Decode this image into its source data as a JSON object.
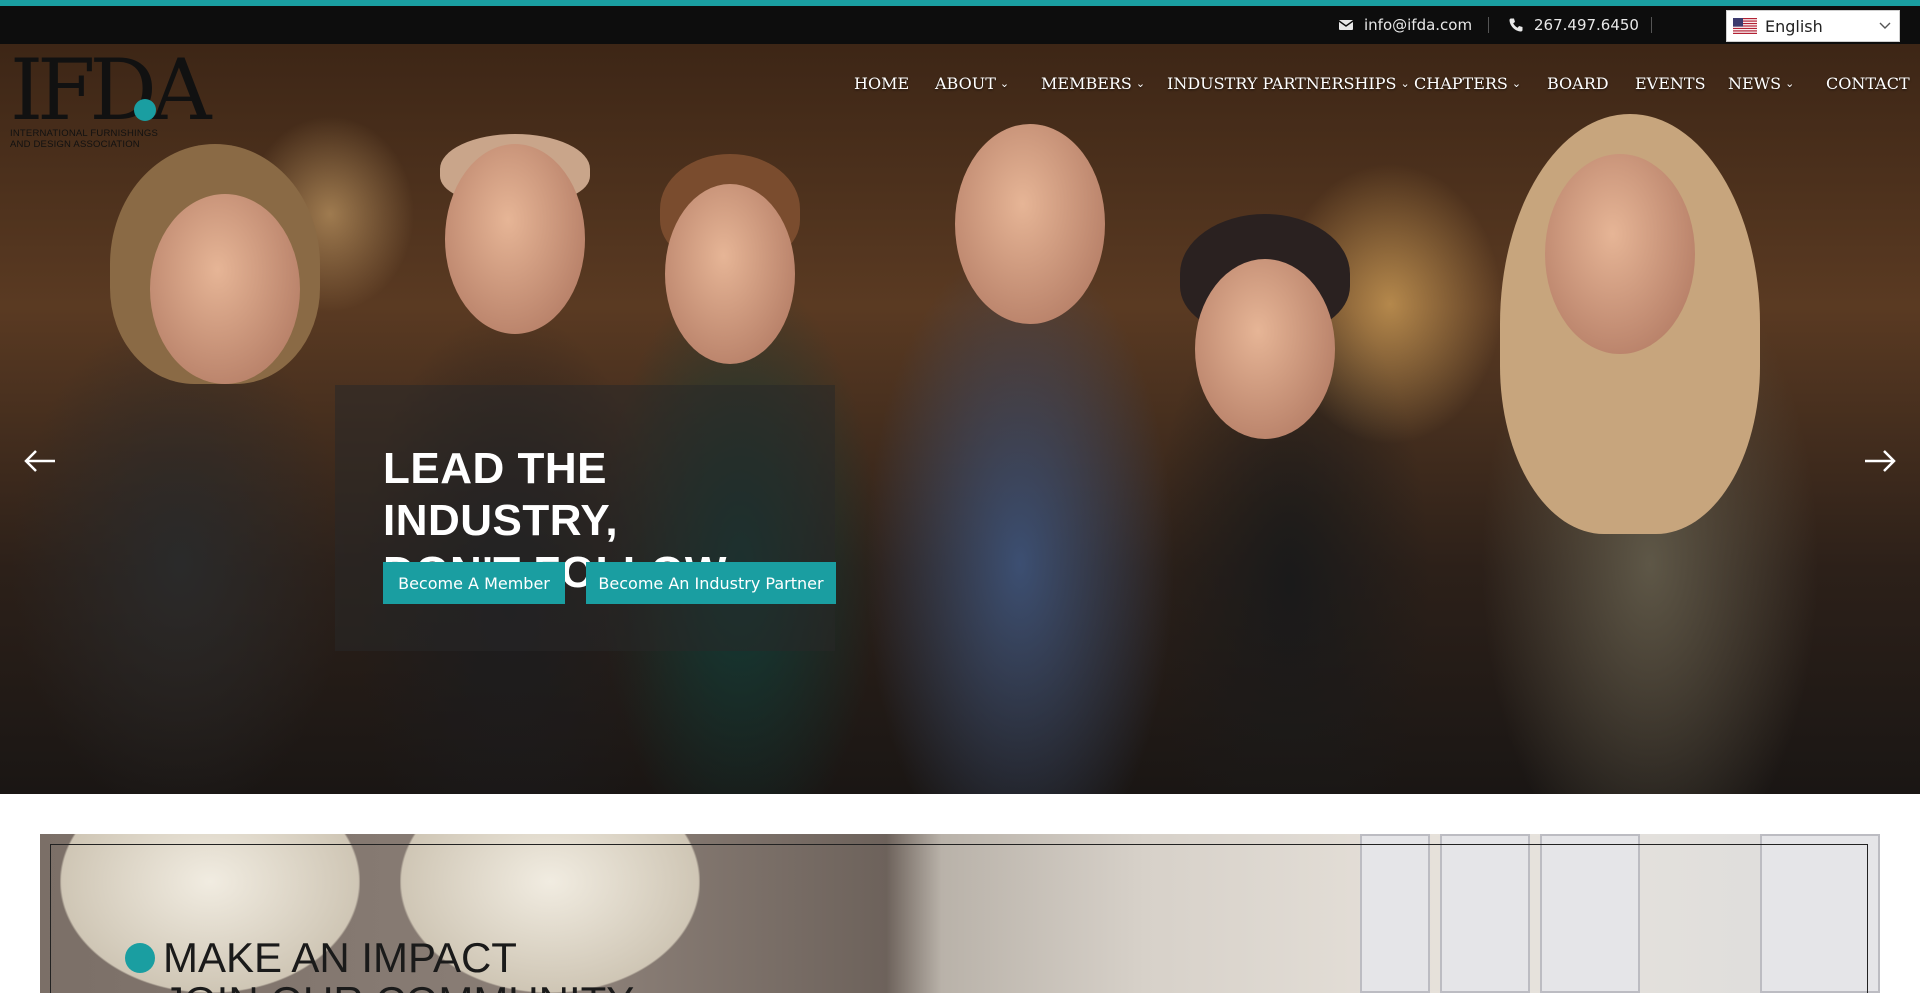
{
  "colors": {
    "accent": "#1a9ea1",
    "topbar": "#0d0d0d"
  },
  "contact": {
    "email": "info@ifda.com",
    "phone": "267.497.6450",
    "email_icon": "envelope-icon",
    "phone_icon": "phone-icon"
  },
  "language": {
    "selected": "English",
    "flag_icon": "us-flag-icon",
    "chevron_icon": "chevron-down-icon"
  },
  "logo": {
    "letters": "IFDA",
    "line1": "INTERNATIONAL FURNISHINGS",
    "line2": "AND DESIGN ASSOCIATION"
  },
  "nav": {
    "items": [
      {
        "label": "HOME",
        "dropdown": false
      },
      {
        "label": "ABOUT",
        "dropdown": true
      },
      {
        "label": "MEMBERS",
        "dropdown": true
      },
      {
        "label": "INDUSTRY PARTNERSHIPS",
        "dropdown": true
      },
      {
        "label": "CHAPTERS",
        "dropdown": true
      },
      {
        "label": "BOARD",
        "dropdown": false
      },
      {
        "label": "EVENTS",
        "dropdown": false
      },
      {
        "label": "NEWS",
        "dropdown": true
      },
      {
        "label": "CONTACT",
        "dropdown": false
      }
    ]
  },
  "hero": {
    "title_line1": "LEAD THE INDUSTRY,",
    "title_line2": "DON'T FOLLOW",
    "member_button": "Become A Member",
    "partner_button": "Become An Industry Partner",
    "prev_icon": "arrow-left-icon",
    "next_icon": "arrow-right-icon"
  },
  "section": {
    "heading_line1": "MAKE AN IMPACT",
    "heading_line2": "JOIN OUR COMMUNITY"
  }
}
